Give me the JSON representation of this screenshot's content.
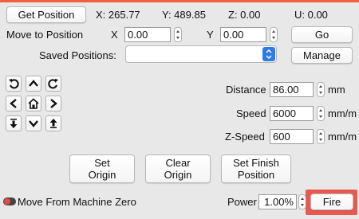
{
  "position": {
    "get_position_label": "Get Position",
    "x_readout": "X: 265.77",
    "y_readout": "Y: 489.85",
    "z_readout": "Z: 0.00",
    "u_readout": "U: 0.00"
  },
  "move": {
    "label": "Move to Position",
    "x_label": "X",
    "x_value": "0.00",
    "y_label": "Y",
    "y_value": "0.00",
    "go_label": "Go"
  },
  "saved": {
    "label": "Saved Positions:",
    "selected": "",
    "manage_label": "Manage"
  },
  "jog": {
    "buttons": [
      "rotate-ccw-icon",
      "arrow-up-icon",
      "rotate-cw-icon",
      "arrow-left-icon",
      "home-icon",
      "arrow-right-icon",
      "z-down-icon",
      "arrow-down-icon",
      "z-up-icon"
    ]
  },
  "params": {
    "distance_label": "Distance",
    "distance_value": "86.00",
    "distance_unit": "mm",
    "speed_label": "Speed",
    "speed_value": "6000",
    "speed_unit": "mm/m",
    "zspeed_label": "Z-Speed",
    "zspeed_value": "600",
    "zspeed_unit": "mm/m"
  },
  "origin": {
    "set_origin_line1": "Set",
    "set_origin_line2": "Origin",
    "clear_origin_line1": "Clear",
    "clear_origin_line2": "Origin",
    "set_finish_line1": "Set Finish",
    "set_finish_line2": "Position"
  },
  "footer": {
    "toggle_label": "Move From Machine Zero",
    "toggle_on": false,
    "power_label": "Power",
    "power_value": "1.00%",
    "fire_label": "Fire"
  },
  "colors": {
    "top_accent": "#f0603a",
    "fire_highlight": "#e85a4f",
    "select_arrow_bg": "#2f7be6"
  }
}
